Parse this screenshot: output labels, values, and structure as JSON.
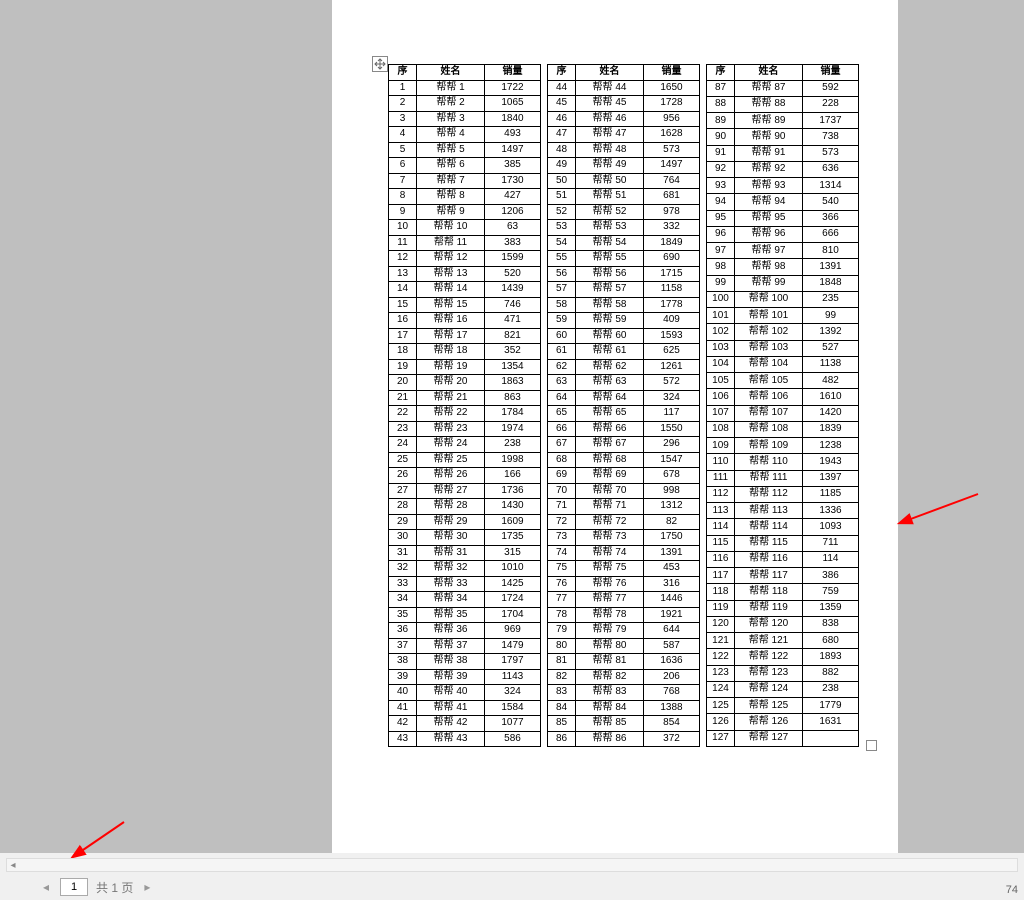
{
  "headers": {
    "seq": "序",
    "name": "姓名",
    "sales": "销量"
  },
  "name_prefix": "帮帮 ",
  "columns": [
    [
      {
        "s": 1,
        "v": 1722
      },
      {
        "s": 2,
        "v": 1065
      },
      {
        "s": 3,
        "v": 1840
      },
      {
        "s": 4,
        "v": 493
      },
      {
        "s": 5,
        "v": 1497
      },
      {
        "s": 6,
        "v": 385
      },
      {
        "s": 7,
        "v": 1730
      },
      {
        "s": 8,
        "v": 427
      },
      {
        "s": 9,
        "v": 1206
      },
      {
        "s": 10,
        "v": 63
      },
      {
        "s": 11,
        "v": 383
      },
      {
        "s": 12,
        "v": 1599
      },
      {
        "s": 13,
        "v": 520
      },
      {
        "s": 14,
        "v": 1439
      },
      {
        "s": 15,
        "v": 746
      },
      {
        "s": 16,
        "v": 471
      },
      {
        "s": 17,
        "v": 821
      },
      {
        "s": 18,
        "v": 352
      },
      {
        "s": 19,
        "v": 1354
      },
      {
        "s": 20,
        "v": 1863
      },
      {
        "s": 21,
        "v": 863
      },
      {
        "s": 22,
        "v": 1784
      },
      {
        "s": 23,
        "v": 1974
      },
      {
        "s": 24,
        "v": 238
      },
      {
        "s": 25,
        "v": 1998
      },
      {
        "s": 26,
        "v": 166
      },
      {
        "s": 27,
        "v": 1736
      },
      {
        "s": 28,
        "v": 1430
      },
      {
        "s": 29,
        "v": 1609
      },
      {
        "s": 30,
        "v": 1735
      },
      {
        "s": 31,
        "v": 315
      },
      {
        "s": 32,
        "v": 1010
      },
      {
        "s": 33,
        "v": 1425
      },
      {
        "s": 34,
        "v": 1724
      },
      {
        "s": 35,
        "v": 1704
      },
      {
        "s": 36,
        "v": 969
      },
      {
        "s": 37,
        "v": 1479
      },
      {
        "s": 38,
        "v": 1797
      },
      {
        "s": 39,
        "v": 1143
      },
      {
        "s": 40,
        "v": 324
      },
      {
        "s": 41,
        "v": 1584
      },
      {
        "s": 42,
        "v": 1077
      },
      {
        "s": 43,
        "v": 586
      }
    ],
    [
      {
        "s": 44,
        "v": 1650
      },
      {
        "s": 45,
        "v": 1728
      },
      {
        "s": 46,
        "v": 956
      },
      {
        "s": 47,
        "v": 1628
      },
      {
        "s": 48,
        "v": 573
      },
      {
        "s": 49,
        "v": 1497
      },
      {
        "s": 50,
        "v": 764
      },
      {
        "s": 51,
        "v": 681
      },
      {
        "s": 52,
        "v": 978
      },
      {
        "s": 53,
        "v": 332
      },
      {
        "s": 54,
        "v": 1849
      },
      {
        "s": 55,
        "v": 690
      },
      {
        "s": 56,
        "v": 1715
      },
      {
        "s": 57,
        "v": 1158
      },
      {
        "s": 58,
        "v": 1778
      },
      {
        "s": 59,
        "v": 409
      },
      {
        "s": 60,
        "v": 1593
      },
      {
        "s": 61,
        "v": 625
      },
      {
        "s": 62,
        "v": 1261
      },
      {
        "s": 63,
        "v": 572
      },
      {
        "s": 64,
        "v": 324
      },
      {
        "s": 65,
        "v": 117
      },
      {
        "s": 66,
        "v": 1550
      },
      {
        "s": 67,
        "v": 296
      },
      {
        "s": 68,
        "v": 1547
      },
      {
        "s": 69,
        "v": 678
      },
      {
        "s": 70,
        "v": 998
      },
      {
        "s": 71,
        "v": 1312
      },
      {
        "s": 72,
        "v": 82
      },
      {
        "s": 73,
        "v": 1750
      },
      {
        "s": 74,
        "v": 1391
      },
      {
        "s": 75,
        "v": 453
      },
      {
        "s": 76,
        "v": 316
      },
      {
        "s": 77,
        "v": 1446
      },
      {
        "s": 78,
        "v": 1921
      },
      {
        "s": 79,
        "v": 644
      },
      {
        "s": 80,
        "v": 587
      },
      {
        "s": 81,
        "v": 1636
      },
      {
        "s": 82,
        "v": 206
      },
      {
        "s": 83,
        "v": 768
      },
      {
        "s": 84,
        "v": 1388
      },
      {
        "s": 85,
        "v": 854
      },
      {
        "s": 86,
        "v": 372
      }
    ],
    [
      {
        "s": 87,
        "v": 592
      },
      {
        "s": 88,
        "v": 228
      },
      {
        "s": 89,
        "v": 1737
      },
      {
        "s": 90,
        "v": 738
      },
      {
        "s": 91,
        "v": 573
      },
      {
        "s": 92,
        "v": 636
      },
      {
        "s": 93,
        "v": 1314
      },
      {
        "s": 94,
        "v": 540
      },
      {
        "s": 95,
        "v": 366
      },
      {
        "s": 96,
        "v": 666
      },
      {
        "s": 97,
        "v": 810
      },
      {
        "s": 98,
        "v": 1391
      },
      {
        "s": 99,
        "v": 1848
      },
      {
        "s": 100,
        "v": 235
      },
      {
        "s": 101,
        "v": 99
      },
      {
        "s": 102,
        "v": 1392
      },
      {
        "s": 103,
        "v": 527
      },
      {
        "s": 104,
        "v": 1138
      },
      {
        "s": 105,
        "v": 482
      },
      {
        "s": 106,
        "v": 1610
      },
      {
        "s": 107,
        "v": 1420
      },
      {
        "s": 108,
        "v": 1839
      },
      {
        "s": 109,
        "v": 1238
      },
      {
        "s": 110,
        "v": 1943
      },
      {
        "s": 111,
        "v": 1397
      },
      {
        "s": 112,
        "v": 1185
      },
      {
        "s": 113,
        "v": 1336
      },
      {
        "s": 114,
        "v": 1093
      },
      {
        "s": 115,
        "v": 711
      },
      {
        "s": 116,
        "v": 114
      },
      {
        "s": 117,
        "v": 386
      },
      {
        "s": 118,
        "v": 759
      },
      {
        "s": 119,
        "v": 1359
      },
      {
        "s": 120,
        "v": 838
      },
      {
        "s": 121,
        "v": 680
      },
      {
        "s": 122,
        "v": 1893
      },
      {
        "s": 123,
        "v": 882
      },
      {
        "s": 124,
        "v": 238
      },
      {
        "s": 125,
        "v": 1779
      },
      {
        "s": 126,
        "v": 1631
      },
      {
        "s": 127,
        "v": null
      }
    ]
  ],
  "pager": {
    "current": "1",
    "total_label": "共 1 页"
  },
  "zoom_fragment": "74"
}
